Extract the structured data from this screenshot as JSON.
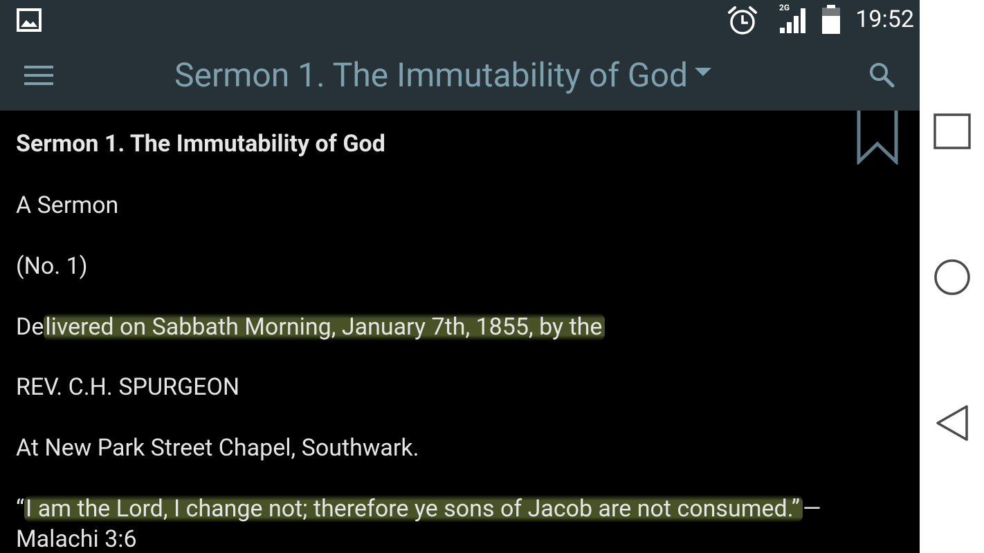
{
  "status_bar": {
    "time": "19:52",
    "network": "2G",
    "icons": [
      "image-icon",
      "alarm-icon",
      "signal-icon",
      "battery-icon"
    ]
  },
  "app_bar": {
    "title": "Sermon 1. The Immutability of God",
    "menu_icon": "menu-icon",
    "dropdown_icon": "dropdown-arrow-icon",
    "search_icon": "search-icon"
  },
  "content": {
    "heading": "Sermon 1. The Immutability of God",
    "subtitle": "A Sermon",
    "number": "(No. 1)",
    "delivered_prefix": "De",
    "delivered_highlight": "livered on Sabbath Morning, January 7th, 1855, by the",
    "author": "REV. C.H. SPURGEON",
    "location": "At New Park Street Chapel, Southwark.",
    "quote_open": "“",
    "quote_highlight": "I am the Lord, I change not; therefore ye sons of Jacob are not consumed.”",
    "quote_dash": "—",
    "reference": "Malachi 3:6"
  },
  "nav_bar": {
    "icons": [
      "recents-icon",
      "home-icon",
      "back-icon"
    ]
  },
  "colors": {
    "status_bar_bg": "#263238",
    "app_bar_bg": "#263238",
    "title_color": "#7ea2ad",
    "text_color": "#e6e6e6",
    "highlight": "#55602d",
    "nav_bar_bg": "#ffffff"
  }
}
